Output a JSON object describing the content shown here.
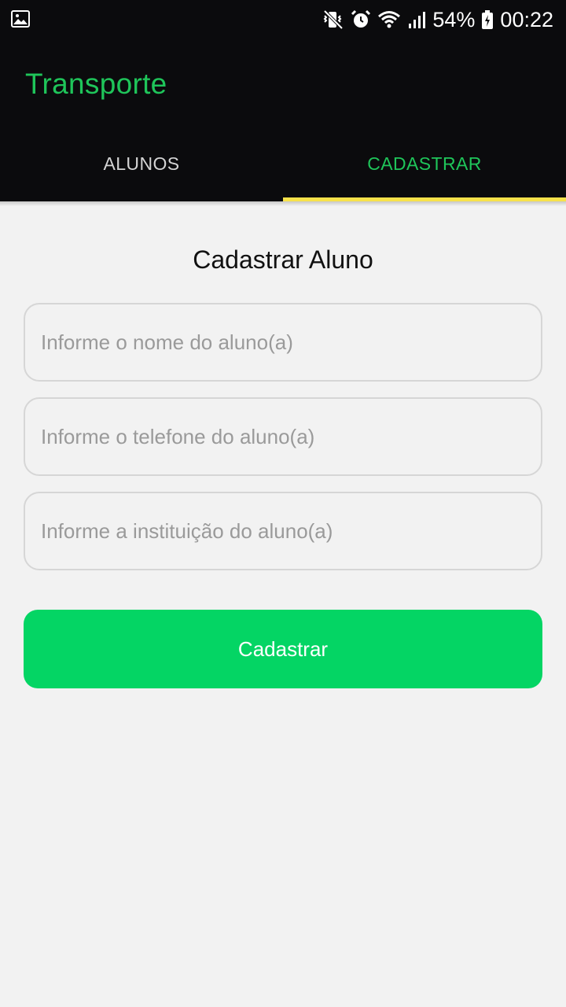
{
  "status_bar": {
    "battery": "54%",
    "time": "00:22",
    "icons": [
      "gallery-icon",
      "mute-vibrate-icon",
      "alarm-icon",
      "wifi-icon",
      "signal-icon",
      "battery-icon"
    ]
  },
  "app": {
    "title": "Transporte",
    "accent_color": "#1fc55a",
    "indicator_color": "#f7e24a"
  },
  "tabs": [
    {
      "label": "ALUNOS",
      "selected": false
    },
    {
      "label": "CADASTRAR",
      "selected": true
    }
  ],
  "form": {
    "title": "Cadastrar Aluno",
    "fields": [
      {
        "placeholder": "Informe o nome do aluno(a)",
        "value": ""
      },
      {
        "placeholder": "Informe o telefone do aluno(a)",
        "value": ""
      },
      {
        "placeholder": "Informe a instituição do aluno(a)",
        "value": ""
      }
    ],
    "submit_label": "Cadastrar",
    "submit_color": "#04d564"
  }
}
